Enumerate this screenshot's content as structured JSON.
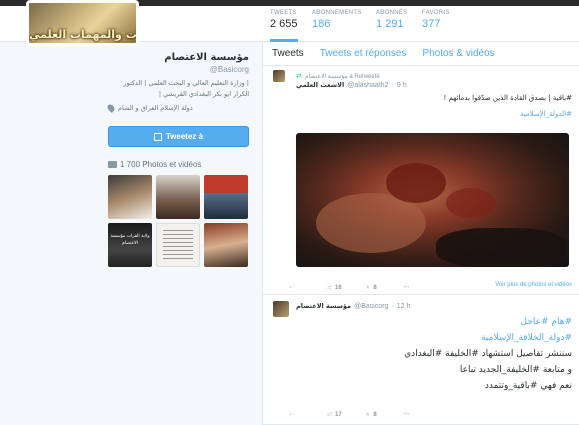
{
  "profile": {
    "avatar_text": "البعثات والمهمات العلمي",
    "name": "مؤسسة الاعتصام",
    "handle": "@Basicorg",
    "bio": "| وزارة التعليم العالي و البحث العلمي | الدكتور الكرار ابو بكر البغدادي القريشي |",
    "location": "دولة الإسلام العراق و الشام",
    "tweet_button": "Tweetez à",
    "photos_label": "1 700 Photos et vidéos",
    "thumb4_text": "ولاية الفرات مؤسسة الاعتصام"
  },
  "stats": [
    {
      "label": "TWEETS",
      "value": "2 655"
    },
    {
      "label": "ABONNEMENTS",
      "value": "186"
    },
    {
      "label": "ABONNÉS",
      "value": "1 291"
    },
    {
      "label": "FAVORIS",
      "value": "377"
    }
  ],
  "tabs": [
    "Tweets",
    "Tweets et réponses",
    "Photos & vidéos"
  ],
  "tweets": [
    {
      "retweet_line": "مؤسسة الاعتصام a Retweeté",
      "author_name": "الاشعث العلمي",
      "author_handle": "@alashaath2",
      "time": "9 h",
      "line1": "#باقية | بصدق القادة الذين صدّقوا بدمائهم !",
      "line2": "#الدولة_الإسلامية",
      "more_media": "Voir plus de photos et vidéos",
      "retweets": "16",
      "favorites": "8"
    },
    {
      "author_name": "مؤسسة الاعتصام",
      "author_handle": "@Basicorg",
      "time": "12 h",
      "line1": "#هام #عاجل",
      "line2": "#دولة_الخلافة_الإسلامية",
      "line3": "سننشر تفاصيل استشهاد #الخليفة #البغدادي",
      "line4": "و متابعة #الخليفة_الجديد تباعا",
      "line5": "نعم فهي #باقية_وتتمدد",
      "retweets": "17",
      "favorites": "8"
    }
  ],
  "icons": {
    "reply": "↩",
    "retweet": "⇄",
    "favorite": "★",
    "more": "•••"
  },
  "colors": {
    "accent": "#55acee",
    "text": "#292f33",
    "muted": "#8899a6"
  }
}
